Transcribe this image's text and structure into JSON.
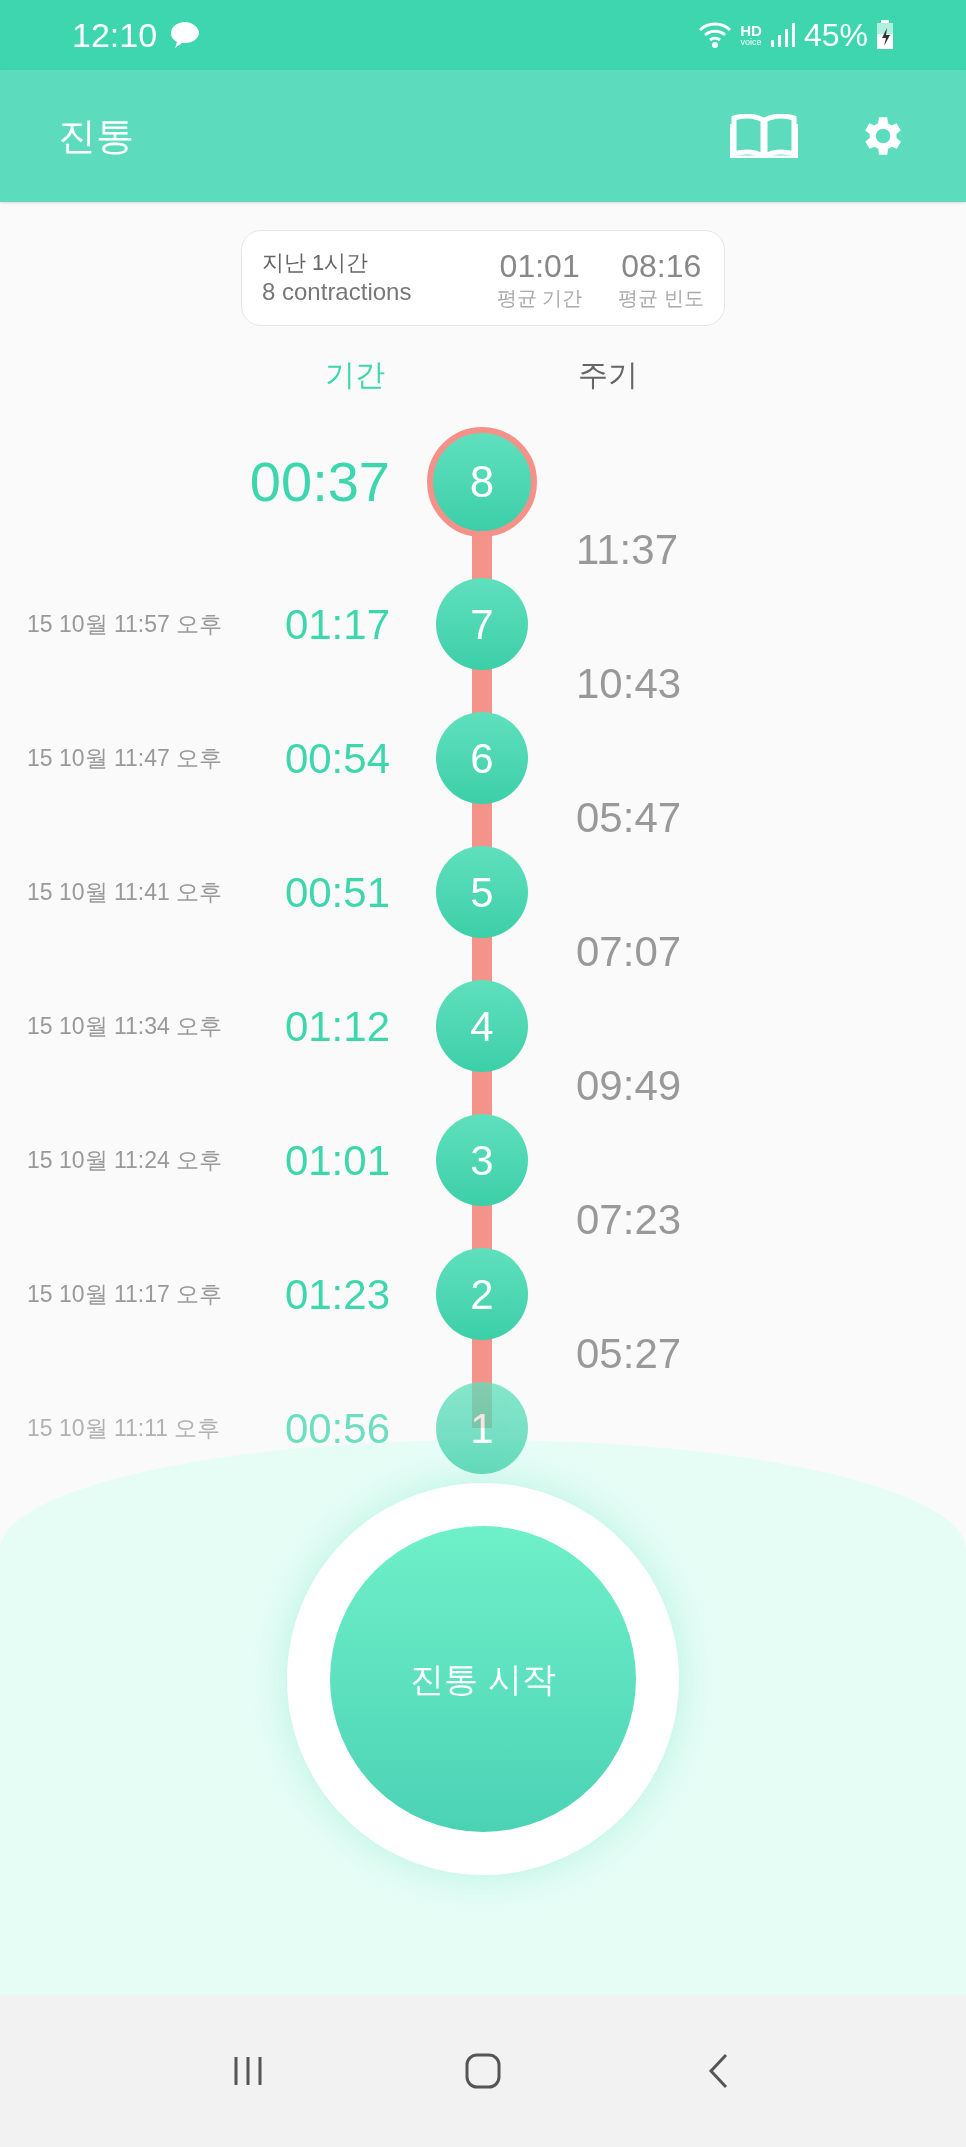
{
  "status_bar": {
    "time": "12:10",
    "network": "HD",
    "network_sub": "voice",
    "battery": "45%"
  },
  "app_bar": {
    "title": "진통"
  },
  "summary": {
    "period": "지난 1시간",
    "count": "8 contractions",
    "avg_duration": "01:01",
    "avg_duration_label": "평균 기간",
    "avg_frequency": "08:16",
    "avg_frequency_label": "평균 빈도"
  },
  "columns": [
    {
      "label": "기간",
      "selected": true
    },
    {
      "label": "주기",
      "selected": false
    }
  ],
  "contractions": [
    {
      "number": "8",
      "duration": "00:37",
      "interval": "11:37",
      "current": true,
      "faded": false
    },
    {
      "number": "7",
      "date": "15 10월 11:57 오후",
      "duration": "01:17",
      "interval": "10:43",
      "current": false,
      "faded": false
    },
    {
      "number": "6",
      "date": "15 10월 11:47 오후",
      "duration": "00:54",
      "interval": "05:47",
      "current": false,
      "faded": false
    },
    {
      "number": "5",
      "date": "15 10월 11:41 오후",
      "duration": "00:51",
      "interval": "07:07",
      "current": false,
      "faded": false
    },
    {
      "number": "4",
      "date": "15 10월 11:34 오후",
      "duration": "01:12",
      "interval": "09:49",
      "current": false,
      "faded": false
    },
    {
      "number": "3",
      "date": "15 10월 11:24 오후",
      "duration": "01:01",
      "interval": "07:23",
      "current": false,
      "faded": false
    },
    {
      "number": "2",
      "date": "15 10월 11:17 오후",
      "duration": "01:23",
      "interval": "05:27",
      "current": false,
      "faded": false
    },
    {
      "number": "1",
      "date": "15 10월 11:11 오후",
      "duration": "00:56",
      "current": false,
      "faded": true
    }
  ],
  "start_button": {
    "label": "진통 시작"
  }
}
